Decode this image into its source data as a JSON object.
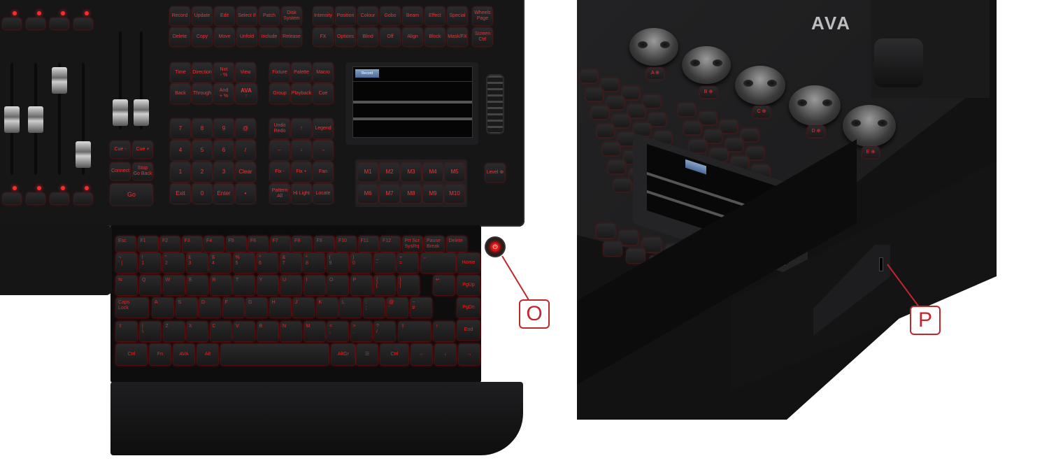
{
  "left_view": {
    "row1_keys": [
      "Record",
      "Update",
      "Edit",
      "Select If",
      "Patch",
      "Disk\nSystem",
      "Intensity",
      "Position",
      "Colour",
      "Gobo",
      "Beam",
      "Effect",
      "Special",
      "Wheels\nPage"
    ],
    "row2_keys": [
      "Delete",
      "Copy",
      "Move",
      "Unfold",
      "Include",
      "Release",
      "FX",
      "Options",
      "Blind",
      "Off",
      "Align",
      "Block",
      "Mask/FX",
      "Screen\nCtrl"
    ],
    "cmd_row1": [
      "Time",
      "Direction",
      "Not\n- %",
      "View"
    ],
    "cmd_row2": [
      "Back",
      "Through",
      "And\n+ %"
    ],
    "pal_row1": [
      "Fixture",
      "Palette",
      "Macro"
    ],
    "pal_row2": [
      "Group",
      "Playback",
      "Cue"
    ],
    "numpad": [
      [
        "7",
        "8",
        "9",
        "@"
      ],
      [
        "4",
        "5",
        "6",
        "/"
      ],
      [
        "1",
        "2",
        "3",
        "Clear"
      ],
      [
        "Exit",
        "0",
        "Enter",
        "•"
      ]
    ],
    "nav_keys": [
      [
        "Undo\nRedo",
        "↑",
        "Legend"
      ],
      [
        "←",
        "↓",
        "→"
      ],
      [
        "Fix -",
        "Fix +",
        "Fan"
      ],
      [
        "Pattern\nAll",
        "Hi Light",
        "Locate"
      ]
    ],
    "cue_keys": [
      "Cue -",
      "Cue +",
      "Connect",
      "Stop\nGo Back",
      "Go"
    ],
    "macro_row1": [
      "M1",
      "M2",
      "M3",
      "M4",
      "M5"
    ],
    "macro_row2": [
      "M6",
      "M7",
      "M8",
      "M9",
      "M10"
    ],
    "level_key": "Level ⊕",
    "brand": "AVA",
    "screen_button": "Record",
    "fkeys": [
      "Esc",
      "F1",
      "F2",
      "F3",
      "F4",
      "F5",
      "F6",
      "F7",
      "F8",
      "F9",
      "F10",
      "F11",
      "F12",
      "Prt Scr\nSysRq",
      "Pause\nBreak",
      "Delete"
    ],
    "kb_row1": [
      "¬\n` |",
      "!\n1",
      "\"\n2",
      "£\n3",
      "$\n4",
      "%\n5",
      "^\n6",
      "&\n7",
      "*\n8",
      "(\n9",
      ")\n0",
      "_\n-",
      "+\n=",
      "←"
    ],
    "kb_row2": [
      "⇆",
      "Q",
      "W",
      "E",
      "R",
      "T",
      "Y",
      "U",
      "I",
      "O",
      "P",
      "{\n[",
      "}\n]",
      "↵"
    ],
    "kb_row3": [
      "Caps\nLock",
      "A",
      "S",
      "D",
      "F",
      "G",
      "H",
      "J",
      "K",
      "L",
      ":\n;",
      "@\n'",
      "~\n#"
    ],
    "kb_row4": [
      "⇧",
      "|\n\\",
      "Z",
      "X",
      "C",
      "V",
      "B",
      "N",
      "M",
      "<\n,",
      ">\n.",
      "?\n/",
      "⇧",
      "↑"
    ],
    "kb_row5": [
      "Ctrl",
      "Fn",
      "AVA",
      "Alt",
      "",
      "AltGr",
      "☰",
      "Ctrl",
      "←",
      "↓",
      "→"
    ],
    "kb_side": [
      "Home",
      "PgUp",
      "PgDn",
      "End"
    ],
    "callout": "O"
  },
  "right_view": {
    "brand": "AVA",
    "encoder_labels": [
      "A ⊕",
      "B ⊕",
      "C ⊕",
      "D ⊕",
      "E ⊕"
    ],
    "callout": "P"
  }
}
